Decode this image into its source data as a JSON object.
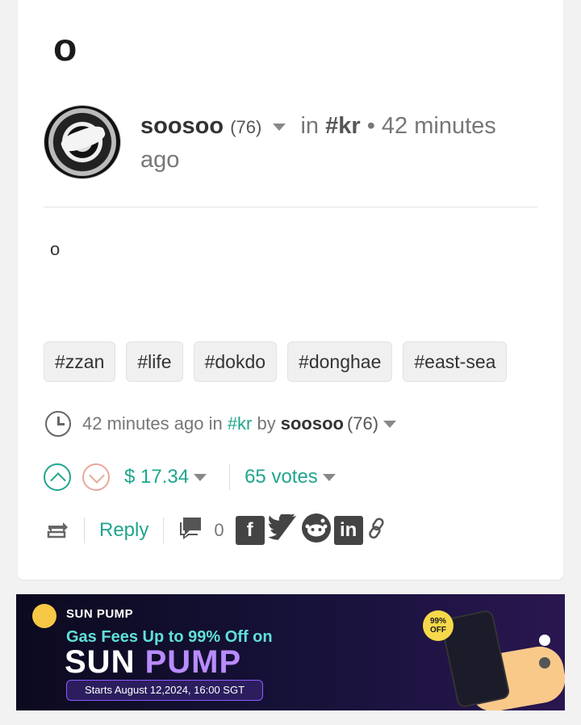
{
  "post": {
    "title": "o",
    "author": "soosoo",
    "reputation": "(76)",
    "in_word": "in",
    "community": "#kr",
    "bullet": "•",
    "time": "42 minutes ago",
    "body": "o"
  },
  "tags": [
    "#zzan",
    "#life",
    "#dokdo",
    "#donghae",
    "#east-sea"
  ],
  "meta": {
    "time": "42 minutes ago",
    "in_word": "in",
    "community": "#kr",
    "by_word": "by",
    "author": "soosoo",
    "reputation": "(76)"
  },
  "voting": {
    "payout": "$ 17.34",
    "votes": "65 votes"
  },
  "actions": {
    "reply": "Reply",
    "comment_count": "0"
  },
  "ad": {
    "brand": "SUN PUMP",
    "headline": "Gas Fees Up to 99% Off on",
    "big_word_1": "SUN",
    "big_word_2": "PUMP",
    "date": "Starts August 12,2024, 16:00 SGT",
    "badge": "99% OFF"
  },
  "colors": {
    "accent": "#1fa58d",
    "downvote": "#e8a89c"
  }
}
